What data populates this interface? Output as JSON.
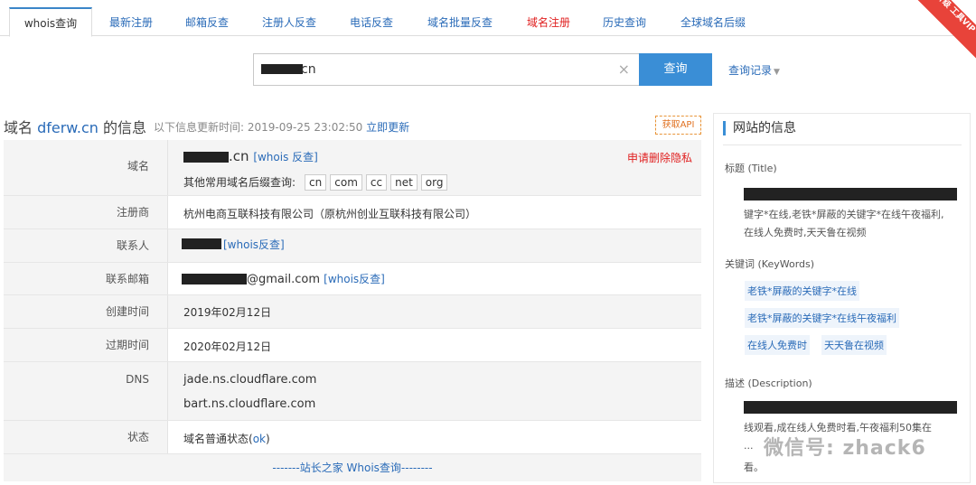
{
  "tabs": [
    "whois查询",
    "最新注册",
    "邮箱反查",
    "注册人反查",
    "电话反查",
    "域名批量反查",
    "域名注册",
    "历史查询",
    "全球域名后缀"
  ],
  "ribbon": "升级 工具VIP",
  "search": {
    "value_suffix": "cn",
    "clear": "×",
    "button": "查询",
    "history": "查询记录",
    "history_caret": "▼"
  },
  "info": {
    "title_prefix": "域名 ",
    "domain": "dferw.cn",
    "title_suffix": " 的信息",
    "update_label": "以下信息更新时间: 2019-09-25 23:02:50 ",
    "update_link": "立即更新",
    "api_button": "获取API"
  },
  "table": {
    "domain": {
      "label": "域名",
      "suffix": ".cn",
      "whois_link": "[whois 反查]",
      "other_label": "其他常用域名后缀查询:",
      "tlds": [
        "cn",
        "com",
        "cc",
        "net",
        "org"
      ],
      "delete_privacy": "申请删除隐私"
    },
    "registrar": {
      "label": "注册商",
      "value": "杭州电商互联科技有限公司（原杭州创业互联科技有限公司）"
    },
    "contact": {
      "label": "联系人",
      "link": "[whois反查]"
    },
    "email": {
      "label": "联系邮箱",
      "value_suffix": "@gmail.com",
      "link": "[whois反查]"
    },
    "created": {
      "label": "创建时间",
      "value": "2019年02月12日"
    },
    "expires": {
      "label": "过期时间",
      "value": "2020年02月12日"
    },
    "dns": {
      "label": "DNS",
      "values": [
        "jade.ns.cloudflare.com",
        "bart.ns.cloudflare.com"
      ]
    },
    "status": {
      "label": "状态",
      "value_prefix": "域名普通状态(",
      "value_link": "ok",
      "value_suffix": ")"
    },
    "footer": "-------站长之家 Whois查询--------"
  },
  "site_panel": {
    "title": "网站的信息",
    "title_label": "标题 (Title)",
    "title_text": [
      "键字*在线,老铁*屏蔽的关键字*在线午夜福利,",
      "在线人免费时,天天鲁在视频"
    ],
    "keywords_label": "关键词 (KeyWords)",
    "keywords": [
      "老铁*屏蔽的关键字*在线",
      "老铁*屏蔽的关键字*在线午夜福利",
      "在线人免费时",
      "天天鲁在视频"
    ],
    "description_label": "描述 (Description)",
    "description_text": [
      "线观看,成在线人免费时看,午夜福利50集在",
      "...",
      "看。"
    ]
  },
  "watermark": "微信号: zhack6",
  "colors": {
    "accent": "#3a8ed6",
    "link": "#2a6bb8",
    "danger": "#e02020",
    "ribbon": "#e8433a"
  }
}
